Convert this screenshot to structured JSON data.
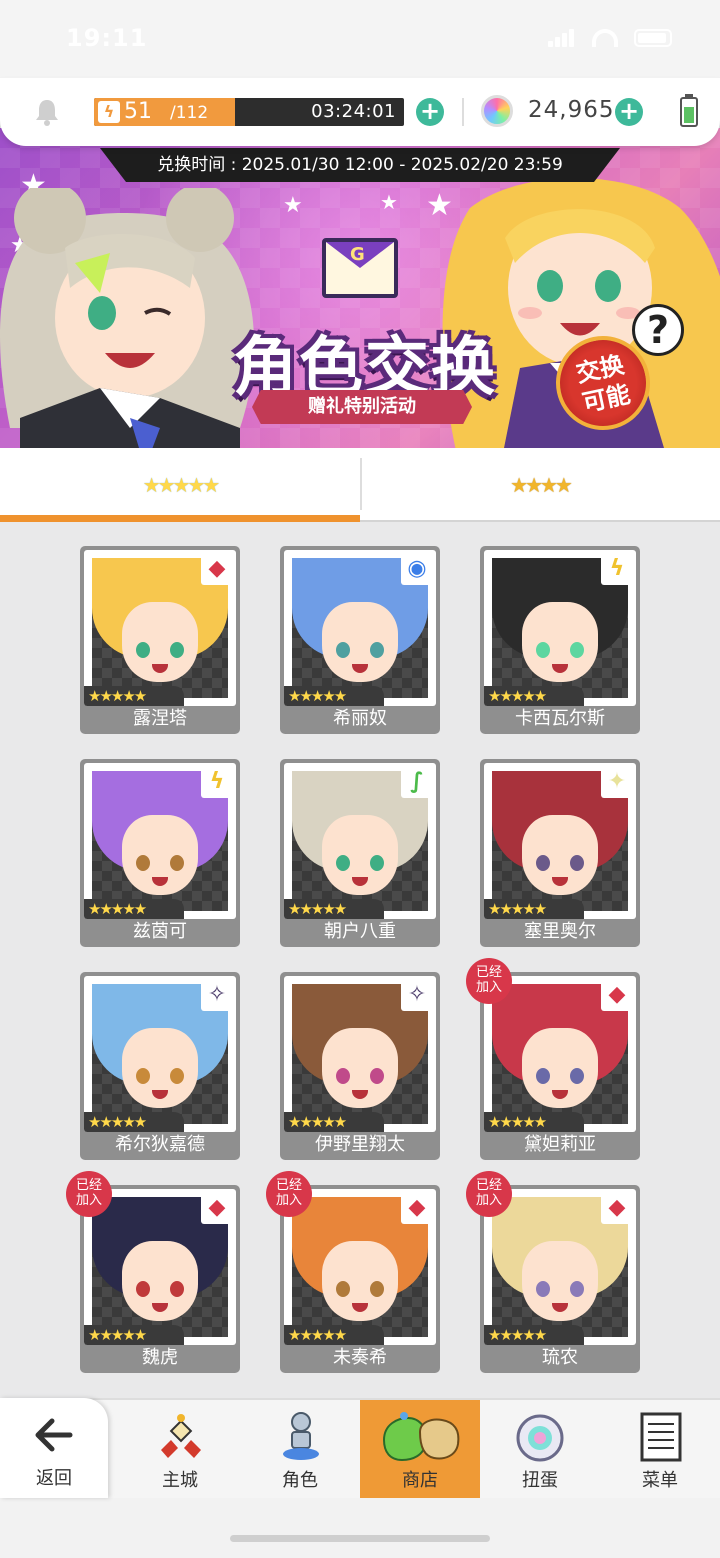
{
  "status_bar": {
    "time": "19:11"
  },
  "resources": {
    "stamina_current": "51",
    "stamina_max": "/112",
    "stamina_fraction": 0.455,
    "stamina_timer": "03:24:01",
    "gem_count": "24,965",
    "plus_label": "+"
  },
  "banner": {
    "exchange_period": "兑换时间 : 2025.01/30 12:00 - 2025.02/20 23:59",
    "title": "角色交换",
    "subtitle": "赠礼特别活动",
    "badge_line1": "交换",
    "badge_line2": "可能",
    "help_label": "?",
    "envelope_letter": "G"
  },
  "tabs": [
    {
      "stars": "★★★★★",
      "active": true
    },
    {
      "stars": "★★★★",
      "active": false
    }
  ],
  "characters": [
    {
      "name": "露涅塔",
      "element": "diamond",
      "element_glyph": "◆",
      "element_color": "#d8374a",
      "stars": "★★★★★",
      "joined": false,
      "hair": "#f7c74e",
      "eye": "#3fae84"
    },
    {
      "name": "希丽奴",
      "element": "water",
      "element_glyph": "◉",
      "element_color": "#3b7ee8",
      "stars": "★★★★★",
      "joined": false,
      "hair": "#6f9de6",
      "eye": "#4fa0a0"
    },
    {
      "name": "卡西瓦尔斯",
      "element": "lightning",
      "element_glyph": "ϟ",
      "element_color": "#f0c22e",
      "stars": "★★★★★",
      "joined": false,
      "hair": "#2b2b2b",
      "eye": "#5dd6a0"
    },
    {
      "name": "兹茵可",
      "element": "lightning",
      "element_glyph": "ϟ",
      "element_color": "#f0c22e",
      "stars": "★★★★★",
      "joined": false,
      "hair": "#a56ee0",
      "eye": "#b07a3a"
    },
    {
      "name": "朝户八重",
      "element": "wind",
      "element_glyph": "∫",
      "element_color": "#4cbb4a",
      "stars": "★★★★★",
      "joined": false,
      "hair": "#d9d3c2",
      "eye": "#3fae84"
    },
    {
      "name": "塞里奥尔",
      "element": "light",
      "element_glyph": "✦",
      "element_color": "#e8e29a",
      "stars": "★★★★★",
      "joined": false,
      "hair": "#a8323c",
      "eye": "#6b5a8a"
    },
    {
      "name": "希尔狄嘉德",
      "element": "dark",
      "element_glyph": "✧",
      "element_color": "#4a3a6a",
      "stars": "★★★★★",
      "joined": false,
      "hair": "#7fb8e8",
      "eye": "#c88a3a"
    },
    {
      "name": "伊野里翔太",
      "element": "dark",
      "element_glyph": "✧",
      "element_color": "#4a3a6a",
      "stars": "★★★★★",
      "joined": false,
      "hair": "#8a5a3a",
      "eye": "#c04a8a"
    },
    {
      "name": "黛妲莉亚",
      "element": "diamond",
      "element_glyph": "◆",
      "element_color": "#d8374a",
      "stars": "★★★★★",
      "joined": true,
      "hair": "#c8384a",
      "eye": "#6a6aa8"
    },
    {
      "name": "魏虎",
      "element": "diamond",
      "element_glyph": "◆",
      "element_color": "#d8374a",
      "stars": "★★★★★",
      "joined": true,
      "hair": "#2a2a4a",
      "eye": "#c03a3a"
    },
    {
      "name": "未奏希",
      "element": "diamond",
      "element_glyph": "◆",
      "element_color": "#d8374a",
      "stars": "★★★★★",
      "joined": true,
      "hair": "#e8853a",
      "eye": "#b07a3a"
    },
    {
      "name": "琉农",
      "element": "diamond",
      "element_glyph": "◆",
      "element_color": "#d8374a",
      "stars": "★★★★★",
      "joined": true,
      "hair": "#ecd89a",
      "eye": "#8a7ab8"
    }
  ],
  "joined_badge": {
    "line1": "已经",
    "line2": "加入"
  },
  "nav": {
    "back": "返回",
    "items": [
      "主城",
      "角色",
      "商店",
      "扭蛋",
      "菜单"
    ],
    "active_index": 2
  },
  "colors": {
    "accent": "#ef922e",
    "plus_green": "#3eb99a",
    "joined_red": "#d8374a"
  }
}
